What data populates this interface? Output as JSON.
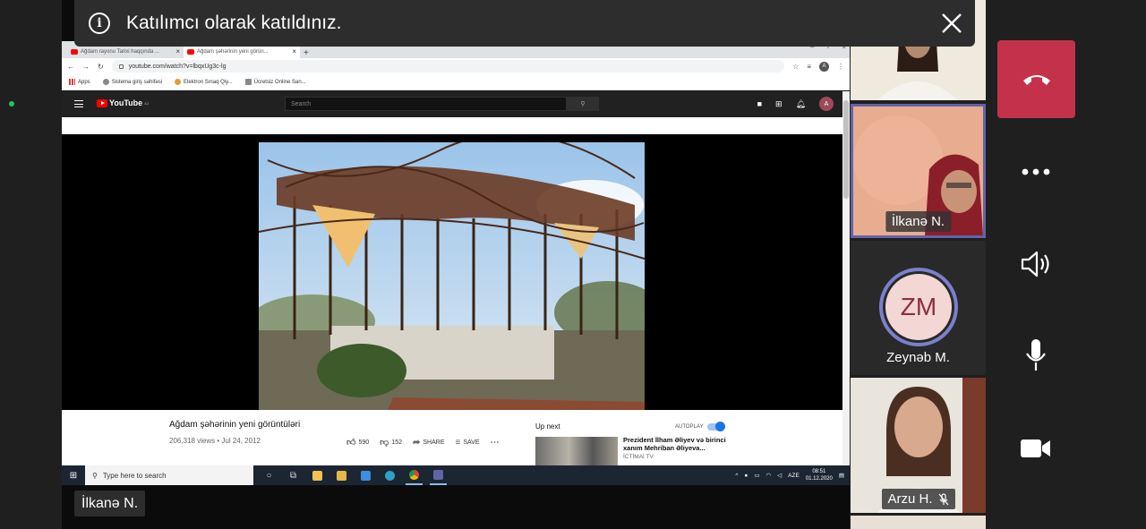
{
  "notification": {
    "message": "Katılımcı olarak katıldınız.",
    "info_glyph": "i"
  },
  "speaker": {
    "name": "İlkanə N."
  },
  "browser": {
    "tabs": [
      {
        "title": "Ağdam rayonu Tarixi haqqında ..."
      },
      {
        "title": "Ağdam şəhərinin yeni görün..."
      }
    ],
    "url": "youtube.com/watch?v=lbqxUg3c-lg",
    "account_letter": "A",
    "bookmarks": [
      "Apps",
      "Sistema giriş səhifəsi",
      "Elektron Sınaq Qiy...",
      "Ücretsiz Online San..."
    ]
  },
  "youtube": {
    "logo_text": "YouTube",
    "region": "AZ",
    "search_placeholder": "Search",
    "account_letter": "A",
    "video": {
      "title": "Ağdam şəhərinin yeni görüntüləri",
      "meta": "206,318 views • Jul 24, 2012",
      "likes": "590",
      "dislikes": "152",
      "share_label": "SHARE",
      "save_label": "SAVE"
    },
    "up_next": {
      "label": "Up next",
      "autoplay_label": "AUTOPLAY",
      "rec_title": "Prezident İlham Əliyev və birinci xanım Mehriban Əliyeva...",
      "rec_channel": "İCTİMAİ TV"
    }
  },
  "taskbar": {
    "search_placeholder": "Type here to search",
    "language": "AZE",
    "time": "08:51",
    "date": "01.12.2020"
  },
  "participants": [
    {
      "name": ""
    },
    {
      "name": "İlkanə N."
    },
    {
      "name": "Zeynəb M.",
      "initials": "ZM"
    },
    {
      "name": "Arzu H."
    }
  ],
  "colors": {
    "hangup": "#c4314b",
    "active_speaker_border": "#6264a7",
    "avatar_ring": "#7b7fce"
  }
}
